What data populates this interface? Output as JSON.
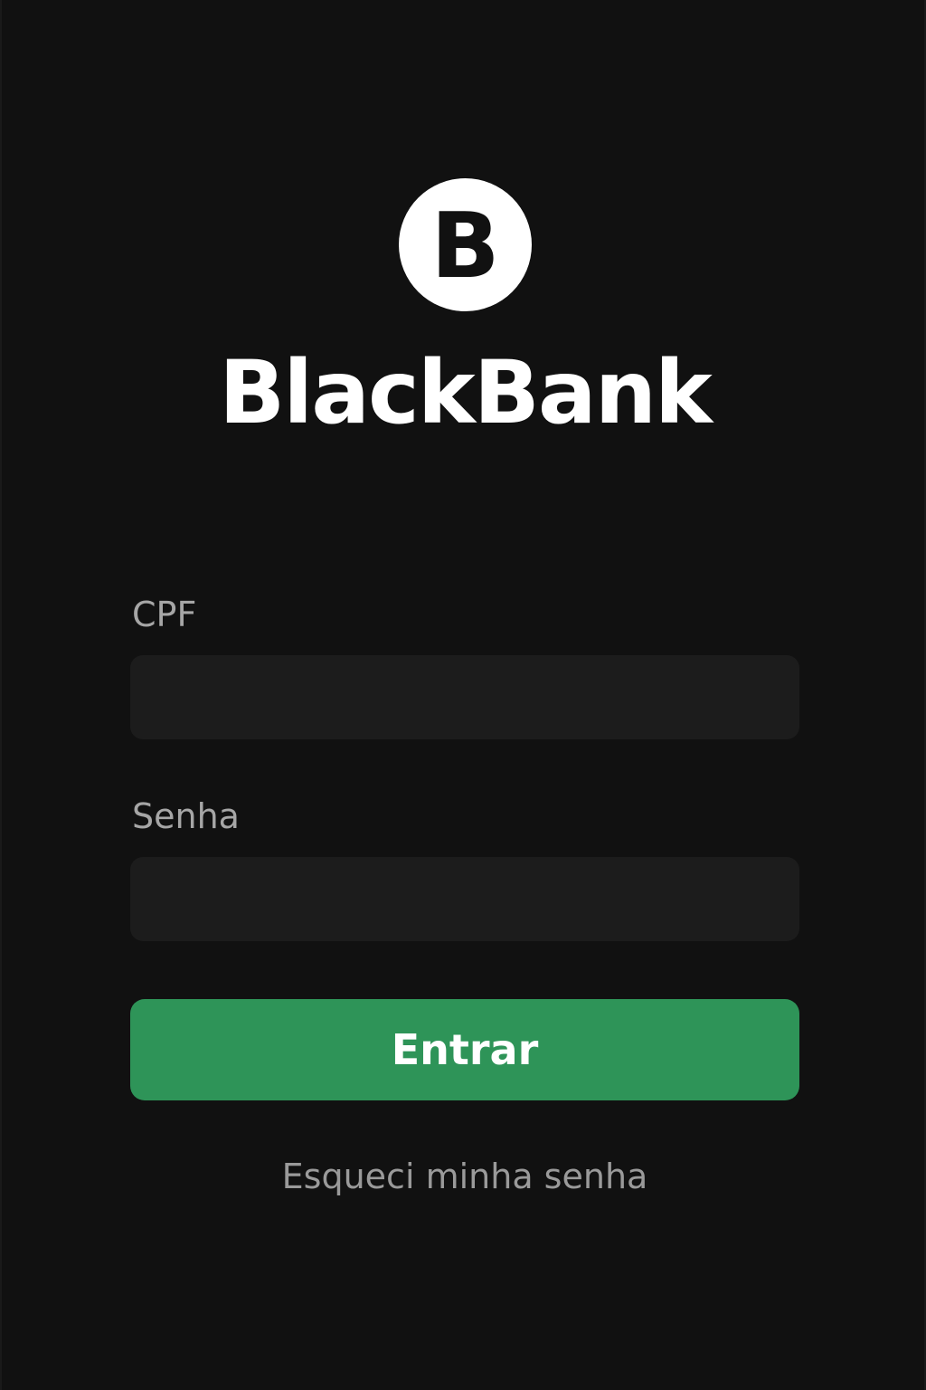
{
  "brand": {
    "logo_letter": "B",
    "name": "BlackBank",
    "icon": "bank-logo-icon"
  },
  "form": {
    "cpf": {
      "label": "CPF",
      "value": "",
      "placeholder": ""
    },
    "password": {
      "label": "Senha",
      "value": "",
      "placeholder": ""
    },
    "submit_label": "Entrar",
    "forgot_password_label": "Esqueci minha senha"
  },
  "colors": {
    "background": "#111111",
    "input_background": "#1c1c1c",
    "accent": "#2e9458",
    "label_text": "#a6a6a6",
    "link_text": "#9a9a9a",
    "brand_text": "#ffffff"
  }
}
